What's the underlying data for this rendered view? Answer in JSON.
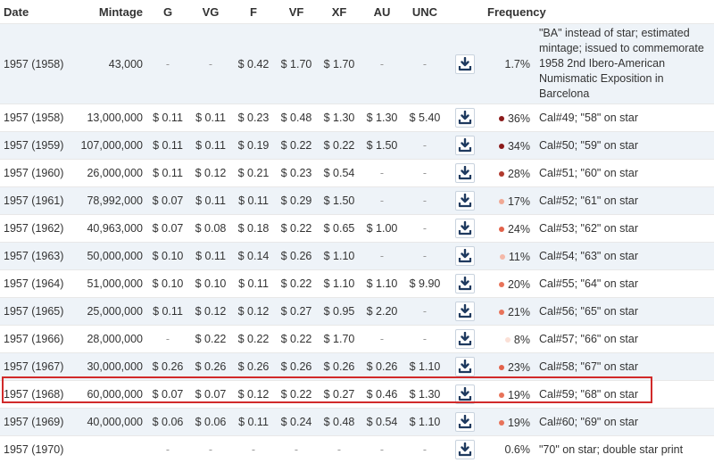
{
  "columns": [
    "Date",
    "Mintage",
    "G",
    "VG",
    "F",
    "VF",
    "XF",
    "AU",
    "UNC",
    "",
    "Frequency",
    ""
  ],
  "rows": [
    {
      "date": "1957 (1958)",
      "mintage": "43,000",
      "g": "-",
      "vg": "-",
      "f": "$ 0.42",
      "vf": "$ 1.70",
      "xf": "$ 1.70",
      "au": "-",
      "unc": "-",
      "freq": "1.7%",
      "dot": "",
      "desc": "\"BA\" instead of star; estimated mintage; issued to commemorate 1958 2nd Ibero-American Numismatic Exposition in Barcelona"
    },
    {
      "date": "1957 (1958)",
      "mintage": "13,000,000",
      "g": "$ 0.11",
      "vg": "$ 0.11",
      "f": "$ 0.23",
      "vf": "$ 0.48",
      "xf": "$ 1.30",
      "au": "$ 1.30",
      "unc": "$ 5.40",
      "freq": "36%",
      "dot": "#8b1a1a",
      "desc": "Cal#49; \"58\" on star"
    },
    {
      "date": "1957 (1959)",
      "mintage": "107,000,000",
      "g": "$ 0.11",
      "vg": "$ 0.11",
      "f": "$ 0.19",
      "vf": "$ 0.22",
      "xf": "$ 0.22",
      "au": "$ 1.50",
      "unc": "-",
      "freq": "34%",
      "dot": "#8b1a1a",
      "desc": "Cal#50; \"59\" on star"
    },
    {
      "date": "1957 (1960)",
      "mintage": "26,000,000",
      "g": "$ 0.11",
      "vg": "$ 0.12",
      "f": "$ 0.21",
      "vf": "$ 0.23",
      "xf": "$ 0.54",
      "au": "-",
      "unc": "-",
      "freq": "28%",
      "dot": "#b03a2e",
      "desc": "Cal#51; \"60\" on star"
    },
    {
      "date": "1957 (1961)",
      "mintage": "78,992,000",
      "g": "$ 0.07",
      "vg": "$ 0.11",
      "f": "$ 0.11",
      "vf": "$ 0.29",
      "xf": "$ 1.50",
      "au": "-",
      "unc": "-",
      "freq": "17%",
      "dot": "#f0a894",
      "desc": "Cal#52; \"61\" on star"
    },
    {
      "date": "1957 (1962)",
      "mintage": "40,963,000",
      "g": "$ 0.07",
      "vg": "$ 0.08",
      "f": "$ 0.18",
      "vf": "$ 0.22",
      "xf": "$ 0.65",
      "au": "$ 1.00",
      "unc": "-",
      "freq": "24%",
      "dot": "#e2624a",
      "desc": "Cal#53; \"62\" on star"
    },
    {
      "date": "1957 (1963)",
      "mintage": "50,000,000",
      "g": "$ 0.10",
      "vg": "$ 0.11",
      "f": "$ 0.14",
      "vf": "$ 0.26",
      "xf": "$ 1.10",
      "au": "-",
      "unc": "-",
      "freq": "11%",
      "dot": "#f4b8a8",
      "desc": "Cal#54; \"63\" on star"
    },
    {
      "date": "1957 (1964)",
      "mintage": "51,000,000",
      "g": "$ 0.10",
      "vg": "$ 0.10",
      "f": "$ 0.11",
      "vf": "$ 0.22",
      "xf": "$ 1.10",
      "au": "$ 1.10",
      "unc": "$ 9.90",
      "freq": "20%",
      "dot": "#e8735a",
      "desc": "Cal#55; \"64\" on star"
    },
    {
      "date": "1957 (1965)",
      "mintage": "25,000,000",
      "g": "$ 0.11",
      "vg": "$ 0.12",
      "f": "$ 0.12",
      "vf": "$ 0.27",
      "xf": "$ 0.95",
      "au": "$ 2.20",
      "unc": "-",
      "freq": "21%",
      "dot": "#e8735a",
      "desc": "Cal#56; \"65\" on star"
    },
    {
      "date": "1957 (1966)",
      "mintage": "28,000,000",
      "g": "-",
      "vg": "$ 0.22",
      "f": "$ 0.22",
      "vf": "$ 0.22",
      "xf": "$ 1.70",
      "au": "-",
      "unc": "-",
      "freq": "8%",
      "dot": "#fbe0d6",
      "desc": "Cal#57; \"66\" on star"
    },
    {
      "date": "1957 (1967)",
      "mintage": "30,000,000",
      "g": "$ 0.26",
      "vg": "$ 0.26",
      "f": "$ 0.26",
      "vf": "$ 0.26",
      "xf": "$ 0.26",
      "au": "$ 0.26",
      "unc": "$ 1.10",
      "freq": "23%",
      "dot": "#e2624a",
      "desc": "Cal#58; \"67\" on star"
    },
    {
      "date": "1957 (1968)",
      "mintage": "60,000,000",
      "g": "$ 0.07",
      "vg": "$ 0.07",
      "f": "$ 0.12",
      "vf": "$ 0.22",
      "xf": "$ 0.27",
      "au": "$ 0.46",
      "unc": "$ 1.30",
      "freq": "19%",
      "dot": "#e8735a",
      "desc": "Cal#59; \"68\" on star"
    },
    {
      "date": "1957 (1969)",
      "mintage": "40,000,000",
      "g": "$ 0.06",
      "vg": "$ 0.06",
      "f": "$ 0.11",
      "vf": "$ 0.24",
      "xf": "$ 0.48",
      "au": "$ 0.54",
      "unc": "$ 1.10",
      "freq": "19%",
      "dot": "#e8735a",
      "desc": "Cal#60; \"69\" on star"
    },
    {
      "date": "1957 (1970)",
      "mintage": "",
      "g": "-",
      "vg": "-",
      "f": "-",
      "vf": "-",
      "xf": "-",
      "au": "-",
      "unc": "-",
      "freq": "0.6%",
      "dot": "",
      "desc": "\"70\" on star; double star print"
    }
  ],
  "colors": {
    "highlight": "#d12a2a",
    "row_alt": "#eef3f8",
    "icon": "#1f3a5f"
  }
}
